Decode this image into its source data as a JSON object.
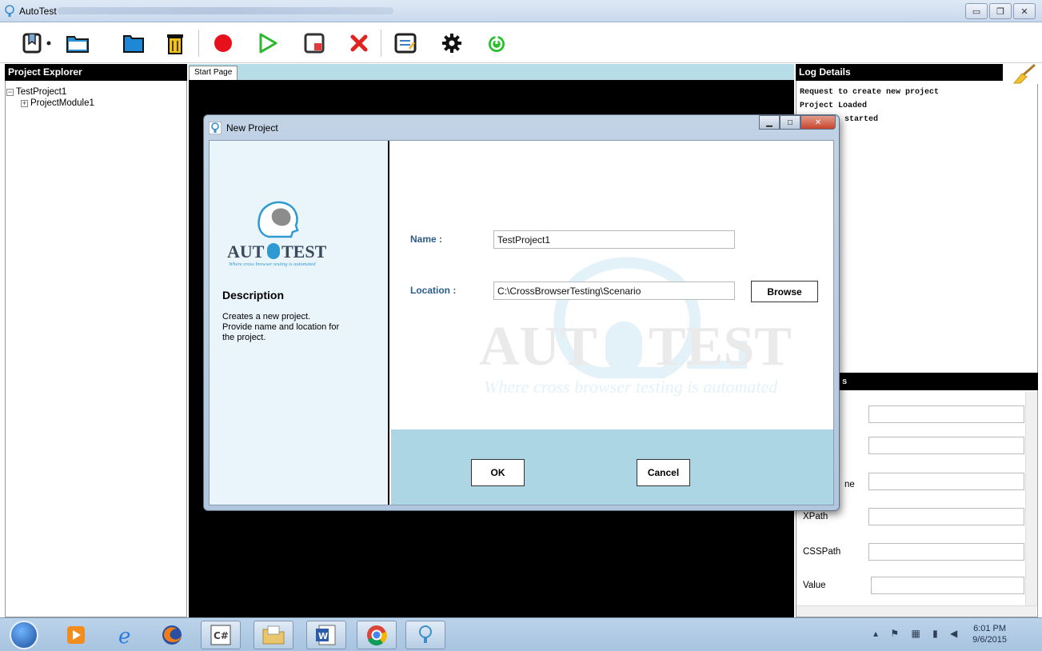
{
  "app": {
    "title": "AutoTest"
  },
  "toolbar": {
    "buttons": [
      "new-project",
      "open-folder",
      "folder",
      "delete",
      "record",
      "play",
      "stop",
      "cancel",
      "report",
      "settings",
      "power"
    ]
  },
  "explorer": {
    "header": "Project Explorer",
    "tree": [
      {
        "label": "TestProject1",
        "toggle": "−"
      },
      {
        "label": "ProjectModule1",
        "toggle": "+"
      }
    ]
  },
  "center": {
    "tab": "Start Page"
  },
  "log": {
    "header": "Log Details",
    "lines": [
      "Request to create new project",
      "Project Loaded",
      "started"
    ]
  },
  "properties": {
    "header": "s",
    "rows": [
      {
        "label": ""
      },
      {
        "label": ""
      },
      {
        "label": "ne"
      },
      {
        "label": "XPath"
      },
      {
        "label": "CSSPath"
      },
      {
        "label": "Value"
      }
    ]
  },
  "dialog": {
    "title": "New Project",
    "logo_text": "AUTOTEST",
    "logo_tagline": "Where cross browser testing is automated",
    "description_title": "Description",
    "description_text": "Creates a new project. Provide name and location for the project.",
    "name_label": "Name :",
    "name_value": "TestProject1",
    "location_label": "Location :",
    "location_value": "C:\\CrossBrowserTesting\\Scenario",
    "browse_label": "Browse",
    "ok_label": "OK",
    "cancel_label": "Cancel"
  },
  "taskbar": {
    "time": "6:01 PM",
    "date": "9/6/2015"
  },
  "colors": {
    "panel_header": "#000000",
    "tab_strip": "#b7dde8",
    "dialog_footer": "#add6e4",
    "label_blue": "#2d5b8a"
  }
}
